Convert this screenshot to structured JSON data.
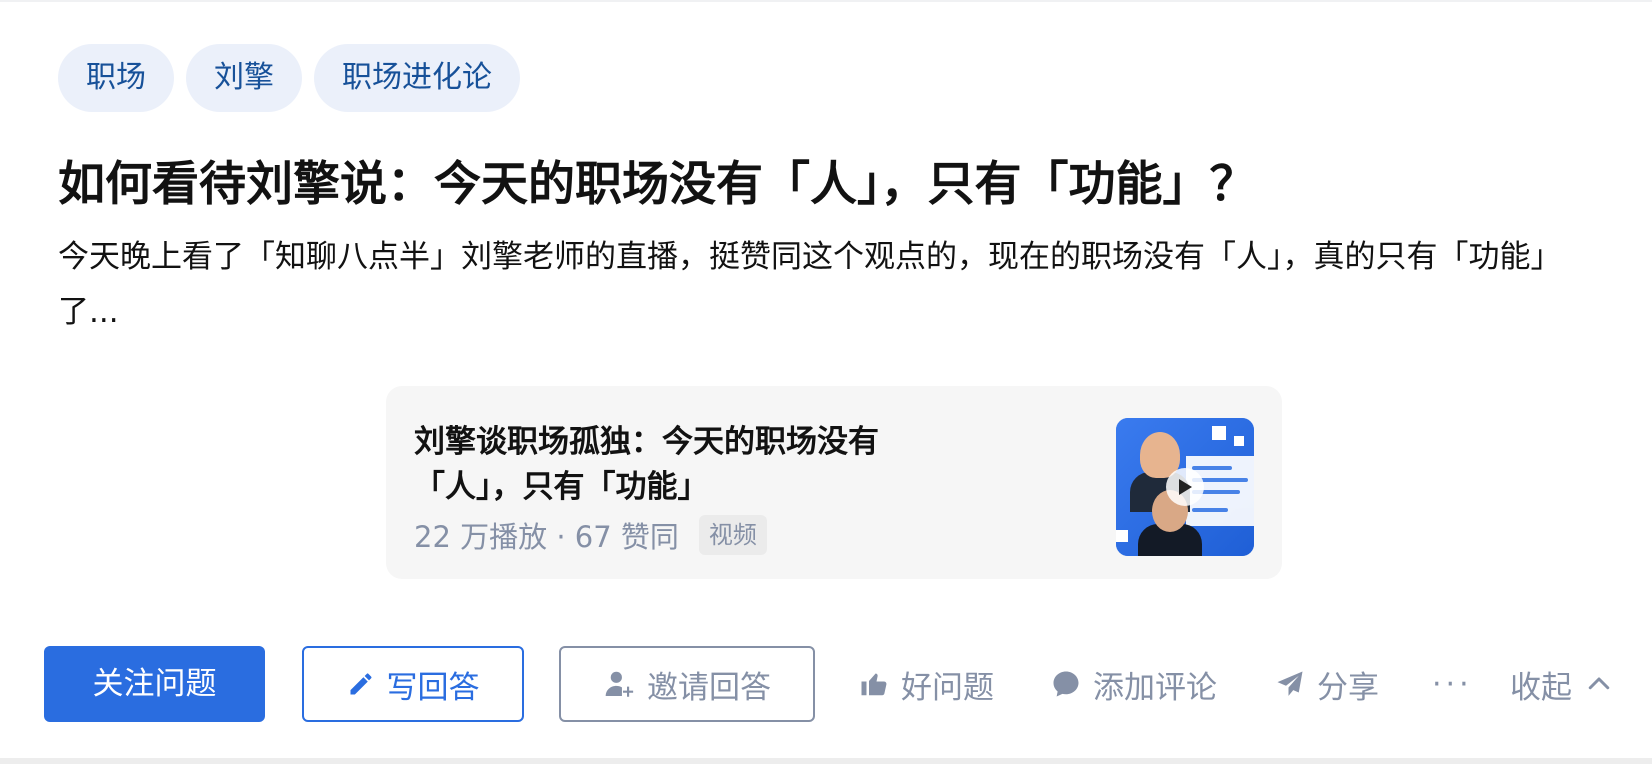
{
  "tags": [
    {
      "label": "职场"
    },
    {
      "label": "刘擎"
    },
    {
      "label": "职场进化论"
    }
  ],
  "question": {
    "title": "如何看待刘擎说：今天的职场没有「人」，只有「功能」？",
    "excerpt": "今天晚上看了「知聊八点半」刘擎老师的直播，挺赞同这个观点的，现在的职场没有「人」，真的只有「功能」了..."
  },
  "video": {
    "title": "刘擎谈职场孤独：今天的职场没有「人」，只有「功能」",
    "meta": "22 万播放 · 67 赞同",
    "badge": "视频",
    "thumbnail_icon": "play-icon"
  },
  "actions": {
    "follow": "关注问题",
    "write": "写回答",
    "invite": "邀请回答",
    "good_question": "好问题",
    "comment": "添加评论",
    "share": "分享",
    "more": "···",
    "collapse": "收起"
  },
  "colors": {
    "primary": "#2a6de0",
    "tag_bg": "#ebf0fa",
    "tag_text": "#175199",
    "muted": "#8590a6"
  }
}
